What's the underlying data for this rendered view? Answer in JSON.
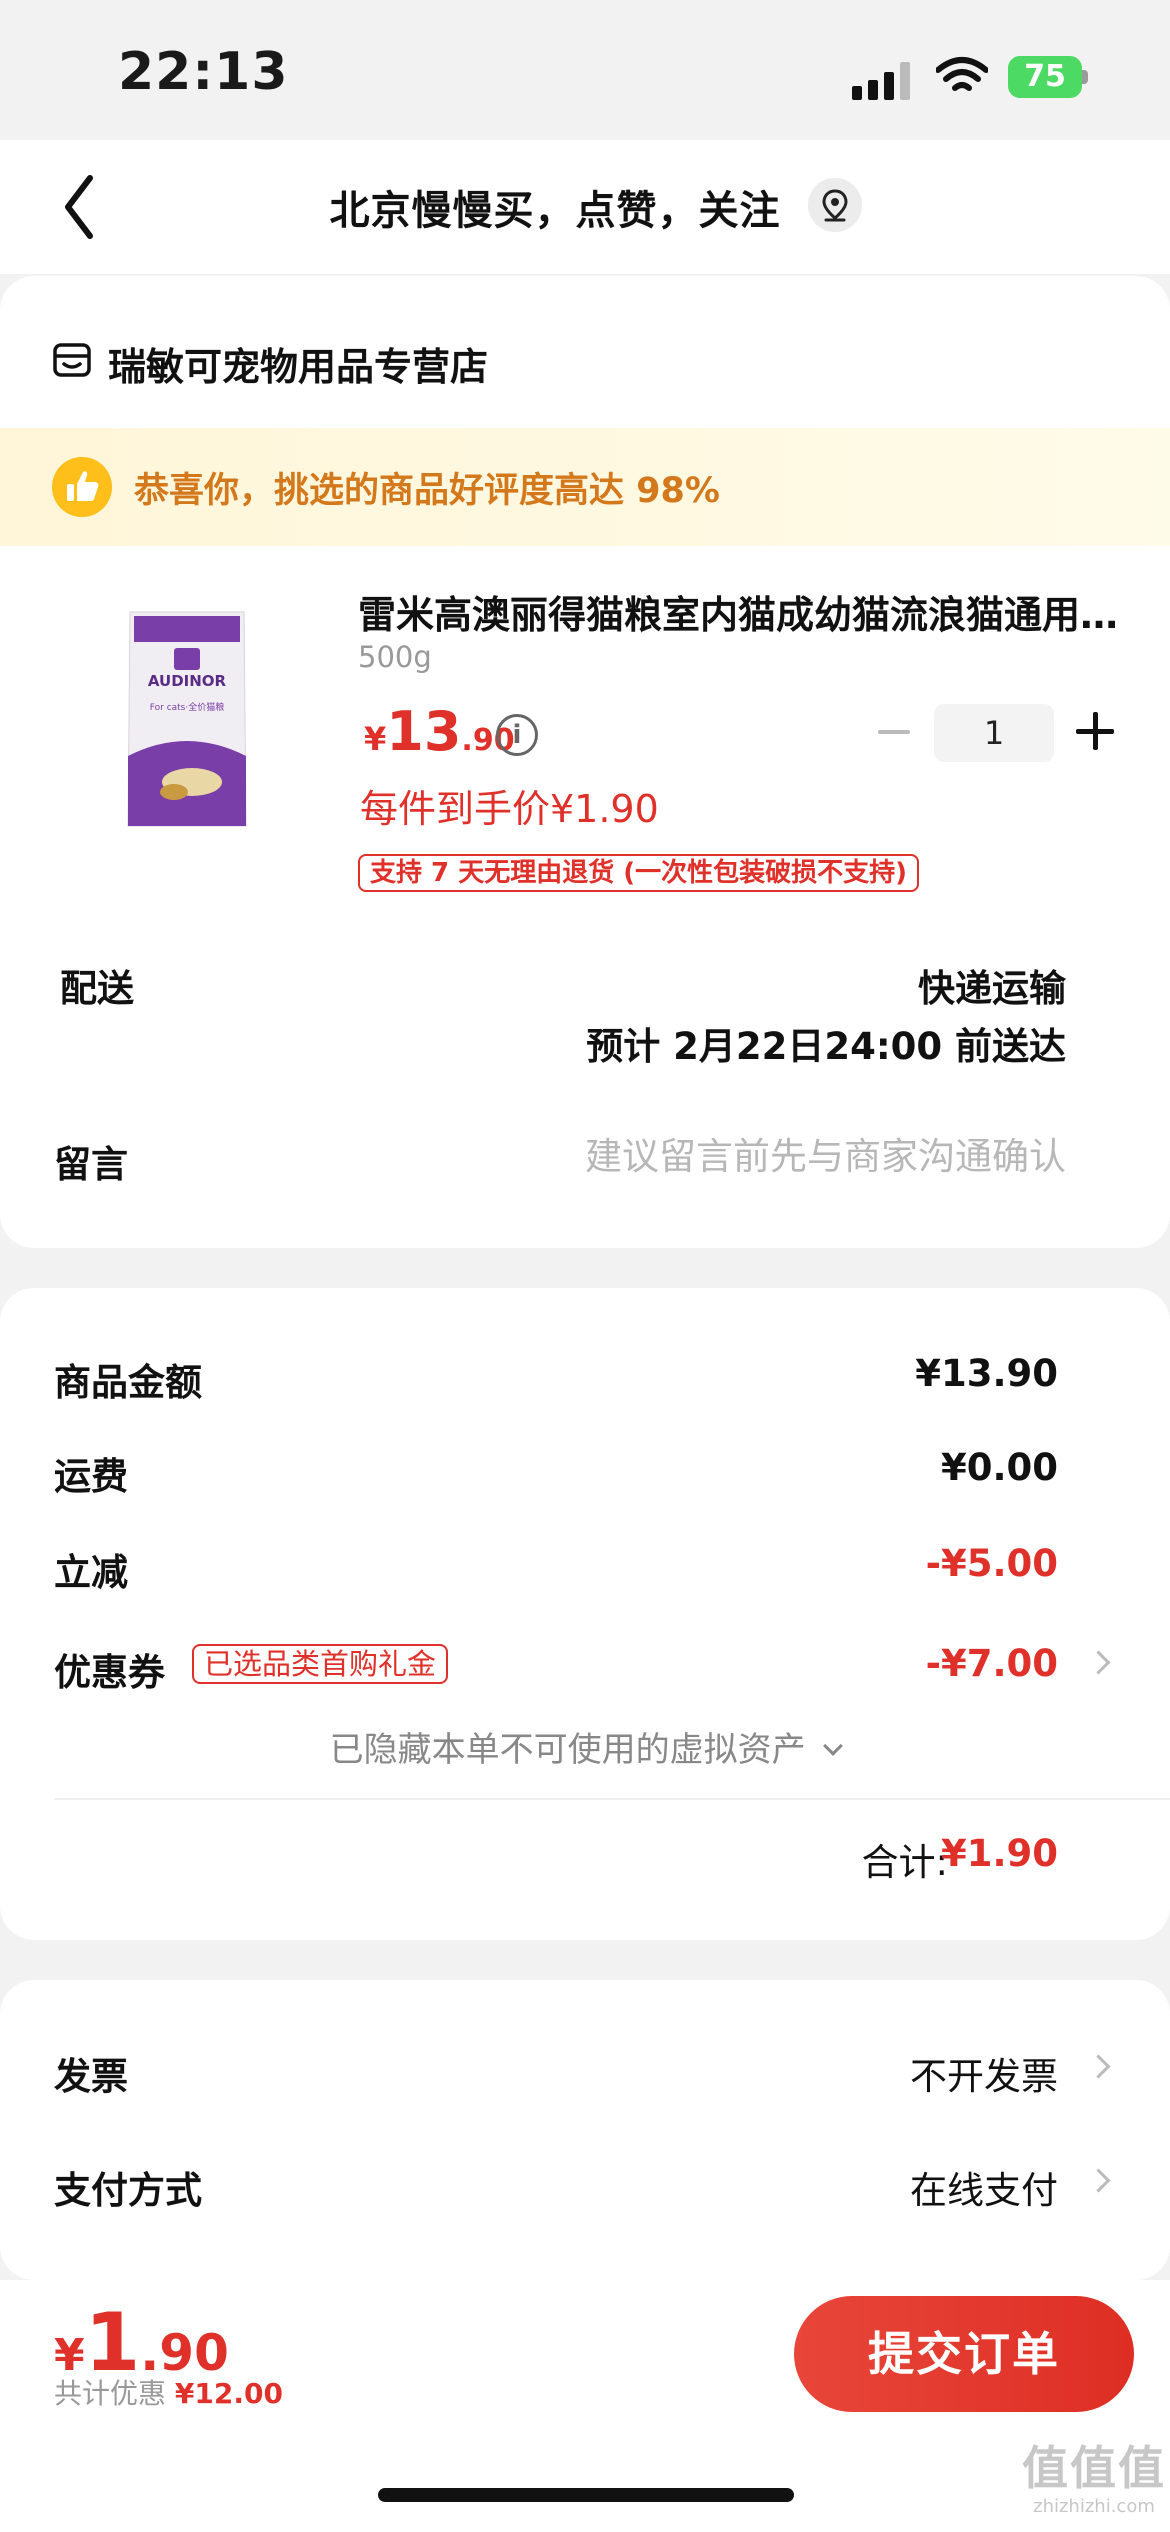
{
  "status_bar": {
    "time": "22:13",
    "battery": "75"
  },
  "nav": {
    "title": "北京慢慢买，点赞，关注"
  },
  "store": {
    "name": "瑞敏可宠物用品专营店"
  },
  "banner": {
    "text": "恭喜你，挑选的商品好评度高达 98%"
  },
  "product": {
    "image_brand": "AUDINOR",
    "image_subtitle": "For cats·全价猫粮",
    "name": "雷米高澳丽得猫粮室内猫成幼猫流浪猫通用型全价猫粮",
    "spec": "500g",
    "price_currency": "¥",
    "price_int": "13",
    "price_dec": ".90",
    "quantity": "1",
    "each_price": "每件到手价¥1.90",
    "return_policy": "支持 7 天无理由退货 (一次性包装破损不支持)"
  },
  "delivery": {
    "label": "配送",
    "method": "快递运输",
    "eta": "预计 2月22日24:00 前送达"
  },
  "message": {
    "label": "留言",
    "placeholder": "建议留言前先与商家沟通确认"
  },
  "summary": {
    "goods_amount_label": "商品金额",
    "goods_amount": "¥13.90",
    "shipping_label": "运费",
    "shipping": "¥0.00",
    "instant_discount_label": "立减",
    "instant_discount": "-¥5.00",
    "coupon_label": "优惠券",
    "coupon_tag": "已选品类首购礼金",
    "coupon_value": "-¥7.00",
    "hidden_assets": "已隐藏本单不可使用的虚拟资产",
    "total_label": "合计:",
    "total_value": "¥1.90"
  },
  "invoice": {
    "label": "发票",
    "value": "不开发票"
  },
  "payment": {
    "label": "支付方式",
    "value": "在线支付"
  },
  "bottom": {
    "price_currency": "¥",
    "price_int": "1",
    "price_dec": ".90",
    "discount_label": "共计优惠",
    "discount_value": "¥12.00",
    "submit_label": "提交订单"
  },
  "watermark": {
    "logo": "值值值",
    "url": "zhizhizhi.com"
  },
  "colors": {
    "accent": "#e0302a",
    "banner_text": "#d4781c",
    "battery": "#4cd964"
  }
}
